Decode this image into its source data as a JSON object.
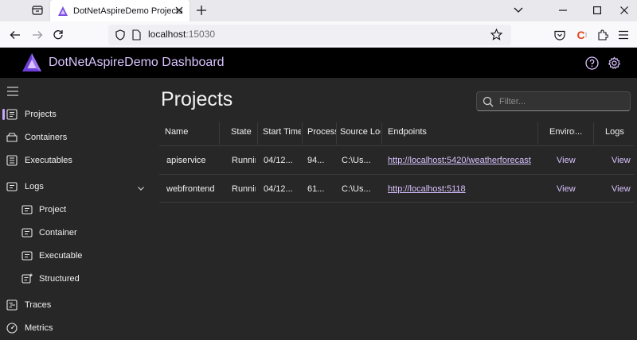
{
  "browser": {
    "tab_title": "DotNetAspireDemo Projects",
    "url_host": "localhost",
    "url_port": ":15030"
  },
  "app": {
    "title": "DotNetAspireDemo Dashboard",
    "accent": "#c5a7ff"
  },
  "sidebar": {
    "items": [
      {
        "label": "Projects",
        "icon": "projects-icon",
        "active": true
      },
      {
        "label": "Containers",
        "icon": "containers-icon"
      },
      {
        "label": "Executables",
        "icon": "executables-icon"
      },
      {
        "label": "Logs",
        "icon": "logs-icon",
        "expanded": true
      },
      {
        "label": "Project",
        "icon": "log-doc-icon"
      },
      {
        "label": "Container",
        "icon": "log-doc-icon"
      },
      {
        "label": "Executable",
        "icon": "log-doc-icon"
      },
      {
        "label": "Structured",
        "icon": "structured-log-icon"
      },
      {
        "label": "Traces",
        "icon": "traces-icon"
      },
      {
        "label": "Metrics",
        "icon": "metrics-icon"
      }
    ]
  },
  "main": {
    "title": "Projects",
    "filter_placeholder": "Filter...",
    "columns": [
      "Name",
      "State",
      "Start Time",
      "Process",
      "Source Location",
      "Endpoints",
      "Environment",
      "Logs"
    ],
    "rows": [
      {
        "name": "apiservice",
        "state": "Running",
        "start": "04/12...",
        "process": "94...",
        "source": "C:\\Us...",
        "endpoint": "http://localhost:5420/weatherforecast",
        "env": "View",
        "logs": "View"
      },
      {
        "name": "webfrontend",
        "state": "Running",
        "start": "04/12...",
        "process": "61...",
        "source": "C:\\Us...",
        "endpoint": "http://localhost:5118",
        "env": "View",
        "logs": "View"
      }
    ]
  }
}
